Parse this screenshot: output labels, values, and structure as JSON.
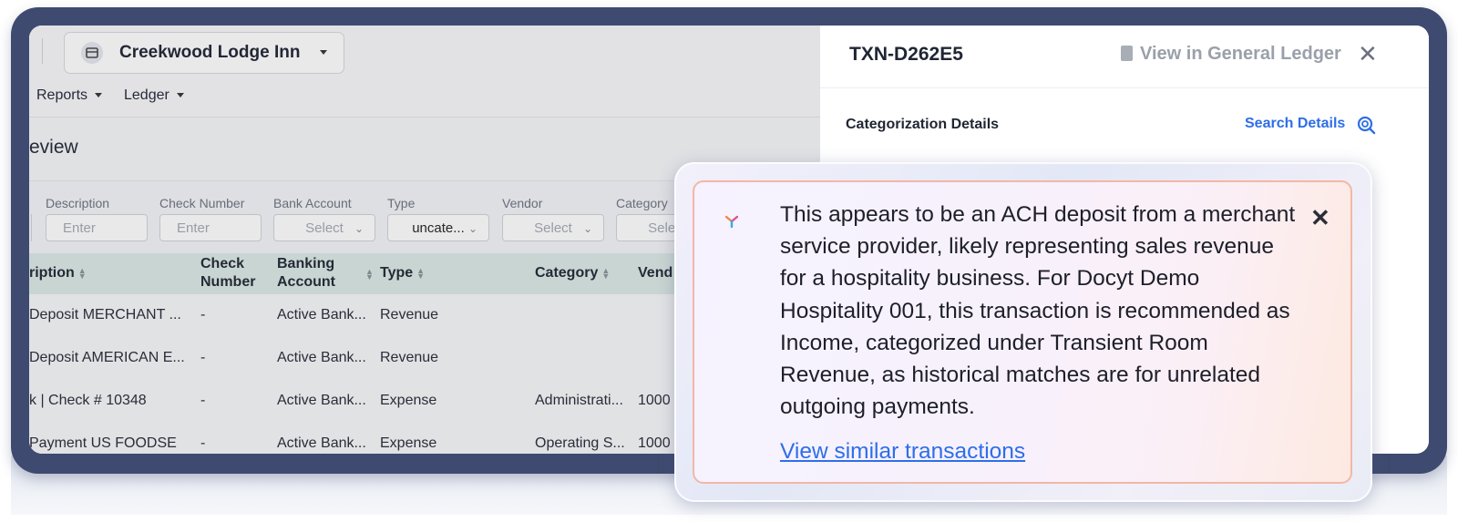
{
  "header": {
    "business_name": "Creekwood Lodge Inn",
    "nav": [
      {
        "label": "Reports"
      },
      {
        "label": "Ledger"
      }
    ]
  },
  "page": {
    "title": "eview"
  },
  "filters": [
    {
      "label": "Description",
      "value": "Enter"
    },
    {
      "label": "Check Number",
      "value": "Enter"
    },
    {
      "label": "Bank Account",
      "value": "Select"
    },
    {
      "label": "Type",
      "value": "uncate..."
    },
    {
      "label": "Vendor",
      "value": "Select"
    },
    {
      "label": "Category",
      "value": "Select"
    }
  ],
  "table": {
    "columns": {
      "description": "ription",
      "check_number_1": "Check",
      "check_number_2": "Number",
      "banking_account_1": "Banking",
      "banking_account_2": "Account",
      "type": "Type",
      "category": "Category",
      "vendor": "Vend"
    },
    "rows": [
      {
        "description": "Deposit MERCHANT ...",
        "check": "-",
        "account": "Active Bank...",
        "type": "Revenue",
        "category": "",
        "vendor": ""
      },
      {
        "description": "Deposit AMERICAN E...",
        "check": "-",
        "account": "Active Bank...",
        "type": "Revenue",
        "category": "",
        "vendor": ""
      },
      {
        "description": "k | Check # 10348",
        "check": "-",
        "account": "Active Bank...",
        "type": "Expense",
        "category": "Administrati...",
        "vendor": "1000"
      },
      {
        "description": "Payment US FOODSE",
        "check": "-",
        "account": "Active Bank...",
        "type": "Expense",
        "category": "Operating S...",
        "vendor": "1000"
      }
    ]
  },
  "panel": {
    "transaction_id": "TXN-D262E5",
    "gl_link": "View in General Ledger",
    "section_title": "Categorization Details",
    "search_details": "Search Details"
  },
  "suggestion": {
    "text": "This appears to be an ACH deposit from a merchant service provider, likely representing sales revenue for a hospitality business. For Docyt Demo Hospitality 001, this transaction is recommended as Income, categorized under Transient Room Revenue, as historical matches are for unrelated outgoing payments.",
    "link": "View similar transactions"
  },
  "colors": {
    "frame": "#3f4a70",
    "accent_link": "#2e6ee6",
    "table_header": "#dbe9e4",
    "popup_border": "#f2b7a6"
  },
  "icons": [
    "store-icon",
    "chevron-down-icon",
    "sort-icon",
    "ledger-doc-icon",
    "close-icon",
    "search-details-icon",
    "docyt-logo-icon"
  ]
}
